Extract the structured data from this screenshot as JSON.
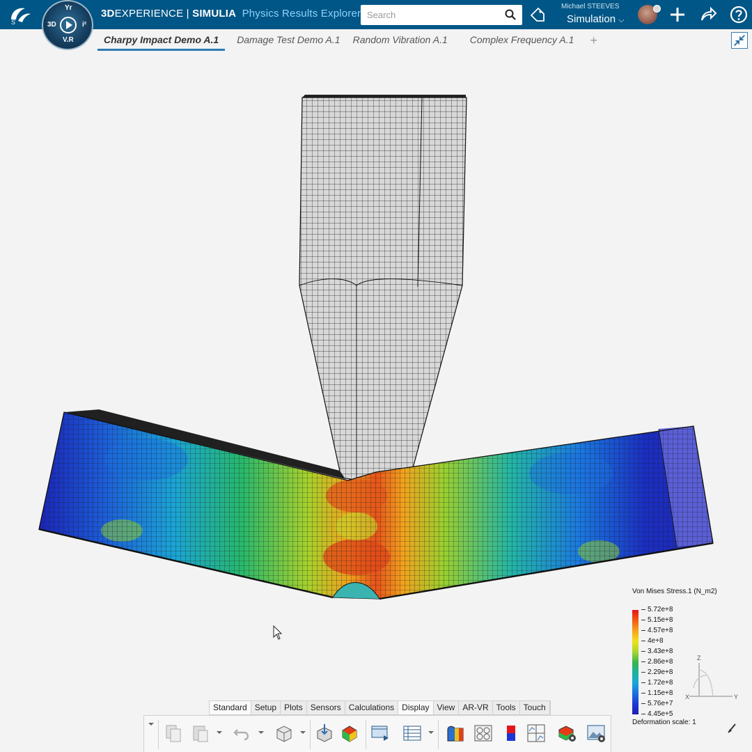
{
  "header": {
    "brand_strong": "3D",
    "brand_rest": "EXPERIENCE | ",
    "brand_product": "SIMULIA",
    "app_name": "Physics Results Explorer",
    "search_placeholder": "Search",
    "user_name": "Michael STEEVES",
    "role": "Simulation",
    "compass": {
      "top": "Yr",
      "left": "3D",
      "right": "i²",
      "bottom": "V.R"
    }
  },
  "tabs": [
    {
      "label": "Charpy Impact Demo A.1",
      "active": true
    },
    {
      "label": "Damage Test Demo A.1",
      "active": false
    },
    {
      "label": "Random Vibration A.1",
      "active": false
    },
    {
      "label": "Complex Frequency A.1",
      "active": false
    }
  ],
  "tab_add": "+",
  "legend": {
    "title": "Von Mises Stress.1 (N_m2)",
    "values": [
      "5.72e+8",
      "5.15e+8",
      "4.57e+8",
      "4e+8",
      "3.43e+8",
      "2.86e+8",
      "2.29e+8",
      "1.72e+8",
      "1.15e+8",
      "5.76e+7",
      "4.45e+5"
    ],
    "deformation": "Deformation scale: 1"
  },
  "triad": {
    "x": "X",
    "y": "Y",
    "z": "Z"
  },
  "ribbon_tabs": [
    {
      "label": "Standard",
      "active": true
    },
    {
      "label": "Setup",
      "active": false
    },
    {
      "label": "Plots",
      "active": false
    },
    {
      "label": "Sensors",
      "active": false
    },
    {
      "label": "Calculations",
      "active": false
    },
    {
      "label": "Display",
      "active": true
    },
    {
      "label": "View",
      "active": false
    },
    {
      "label": "AR-VR",
      "active": false
    },
    {
      "label": "Tools",
      "active": false
    },
    {
      "label": "Touch",
      "active": false
    }
  ],
  "colors": {
    "topbar": "#005686",
    "accent": "#2e7bb4",
    "mesh_gray": "#cfcfcf",
    "stress_max": "#e3151a",
    "stress_min": "#1c1fb0"
  }
}
